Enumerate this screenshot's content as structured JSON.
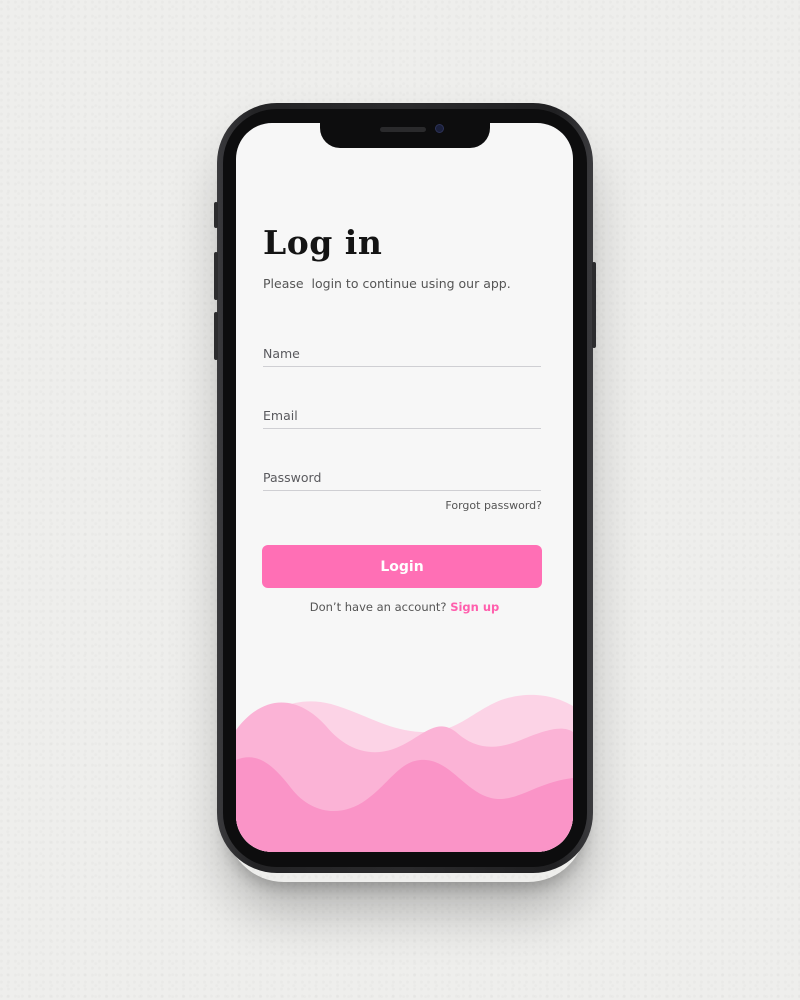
{
  "screen": {
    "title": "Log in",
    "subtitle": "Please  login to continue using our app."
  },
  "form": {
    "name_placeholder": "Name",
    "email_placeholder": "Email",
    "password_placeholder": "Password",
    "forgot_label": "Forgot password?",
    "login_label": "Login"
  },
  "signup": {
    "prompt": "Don’t have an account?",
    "link_label": "Sign up"
  },
  "colors": {
    "accent": "#ff6fb5",
    "link": "#ff5fad",
    "wave_light": "#fcd3e6",
    "wave_mid": "#fbb3d6",
    "wave_dark": "#fa94c7"
  }
}
